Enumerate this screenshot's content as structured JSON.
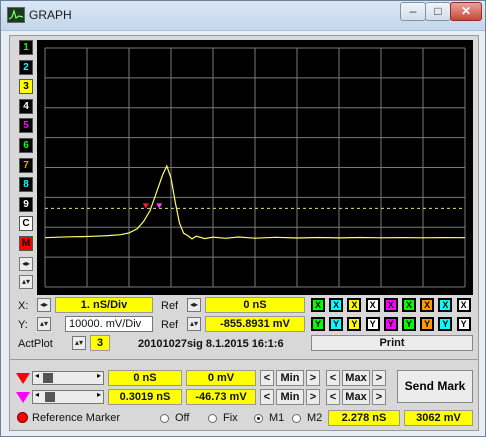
{
  "window": {
    "title": "GRAPH"
  },
  "titlebar": {
    "minimize": "–",
    "maximize": "□",
    "close": "✕"
  },
  "trace_buttons": [
    {
      "label": "1",
      "bg": "#000000",
      "fg": "#00ff00"
    },
    {
      "label": "2",
      "bg": "#000000",
      "fg": "#00ffff"
    },
    {
      "label": "3",
      "bg": "#ffff00",
      "fg": "#000000"
    },
    {
      "label": "4",
      "bg": "#000000",
      "fg": "#ffffff"
    },
    {
      "label": "5",
      "bg": "#000000",
      "fg": "#ff00ff"
    },
    {
      "label": "6",
      "bg": "#000000",
      "fg": "#00ff00"
    },
    {
      "label": "7",
      "bg": "#000000",
      "fg": "#ff9900"
    },
    {
      "label": "8",
      "bg": "#000000",
      "fg": "#00ffff"
    },
    {
      "label": "9",
      "bg": "#000000",
      "fg": "#ffffff"
    },
    {
      "label": "C",
      "bg": "#ffffff",
      "fg": "#000000"
    },
    {
      "label": "M",
      "bg": "#ff0000",
      "fg": "#000000"
    }
  ],
  "x_row": {
    "label": "X:",
    "div_value": "1.  nS/Div",
    "ref_label": "Ref",
    "ref_value": "0  nS"
  },
  "y_row": {
    "label": "Y:",
    "div_value": "10000.  mV/Div",
    "ref_label": "Ref",
    "ref_value": "-855.8931  mV"
  },
  "actplot": {
    "label": "ActPlot",
    "value": "3",
    "info": "20101027sig 8.1.2015 16:1:6",
    "print_label": "Print"
  },
  "x_toggles": [
    "X",
    "X",
    "X",
    "X",
    "X",
    "X",
    "X",
    "X",
    "X"
  ],
  "y_toggles": [
    "Y",
    "Y",
    "Y",
    "Y",
    "Y",
    "Y",
    "Y",
    "Y",
    "Y"
  ],
  "toggle_colors": [
    "#00ff00",
    "#00ffff",
    "#ffff00",
    "#ffffff",
    "#ff00ff",
    "#00ff00",
    "#ff9900",
    "#00ffff",
    "#ffffff"
  ],
  "marker1": {
    "time": "0 nS",
    "volt": "0 mV",
    "min": "Min",
    "max": "Max",
    "lt": "<",
    "gt": ">"
  },
  "marker2": {
    "time": "0.3019 nS",
    "volt": "-46.73 mV",
    "min": "Min",
    "max": "Max",
    "lt": "<",
    "gt": ">"
  },
  "send_mark": "Send Mark",
  "bottom": {
    "ref_marker": "Reference Marker",
    "off": "Off",
    "fix": "Fix",
    "m1": "M1",
    "m2": "M2",
    "delta_time": "2.278 nS",
    "delta_volt": "3062 mV"
  },
  "chart_data": {
    "type": "line",
    "x_div": 1,
    "y_div": 10000,
    "series": [
      {
        "color": "#ffff66",
        "x": [
          0,
          0.3,
          0.6,
          0.9,
          1.2,
          1.5,
          1.8,
          2.0,
          2.2,
          2.35,
          2.5,
          2.6,
          2.7,
          2.8,
          2.9,
          3.0,
          3.1,
          3.2,
          3.3,
          3.4,
          3.5,
          3.6,
          3.8,
          4.0,
          4.3,
          4.6,
          5.0,
          5.5,
          6.0,
          6.5,
          7.0,
          7.5,
          8.0,
          8.5,
          9.0,
          9.5,
          10.0
        ],
        "y": [
          0,
          180,
          300,
          380,
          520,
          700,
          1000,
          1600,
          3000,
          5500,
          9000,
          13000,
          17000,
          21000,
          24000,
          20000,
          12000,
          5000,
          1500,
          700,
          -400,
          500,
          -300,
          200,
          -200,
          250,
          -150,
          150,
          -100,
          80,
          -60,
          60,
          -40,
          40,
          -30,
          20,
          0
        ]
      }
    ]
  }
}
